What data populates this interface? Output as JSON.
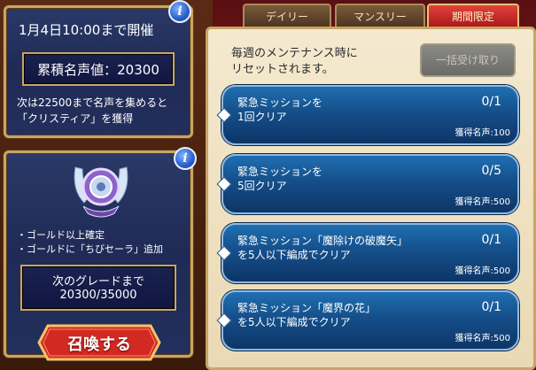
{
  "event": {
    "deadline": "1月4日10:00まで開催",
    "fame_total": "累積名声値：20300",
    "next_reward_line1": "次は22500まで名声を集めると",
    "next_reward_line2": "「クリスティア」を獲得"
  },
  "gacha": {
    "bullet1": "・ゴールド以上確定",
    "bullet2": "・ゴールドに「ちびセーラ」追加",
    "next_grade_label": "次のグレードまで",
    "next_grade_value": "20300/35000",
    "summon_label": "召喚する"
  },
  "tabs": [
    {
      "label": "デイリー"
    },
    {
      "label": "マンスリー"
    },
    {
      "label": "期間限定"
    }
  ],
  "reset_note_line1": "毎週のメンテナンス時に",
  "reset_note_line2": "リセットされます。",
  "claim_all_label": "一括受け取り",
  "missions": [
    {
      "line1": "緊急ミッションを",
      "line2": "1回クリア",
      "progress": "0/1",
      "reward": "獲得名声:100"
    },
    {
      "line1": "緊急ミッションを",
      "line2": "5回クリア",
      "progress": "0/5",
      "reward": "獲得名声:500"
    },
    {
      "line1": "緊急ミッション「魔除けの破魔矢」",
      "line2": "を5人以下編成でクリア",
      "progress": "0/1",
      "reward": "獲得名声:500"
    },
    {
      "line1": "緊急ミッション「魔界の花」",
      "line2": "を5人以下編成でクリア",
      "progress": "0/1",
      "reward": "獲得名声:500"
    }
  ],
  "colors": {
    "accent_gold": "#c9a565",
    "panel_navy": "#1f2a55",
    "mission_blue": "#154f8a",
    "summon_red": "#d22a22",
    "active_tab_red": "#c42524"
  },
  "icons": {
    "info": "info-icon",
    "emblem": "crest-emblem-icon"
  }
}
